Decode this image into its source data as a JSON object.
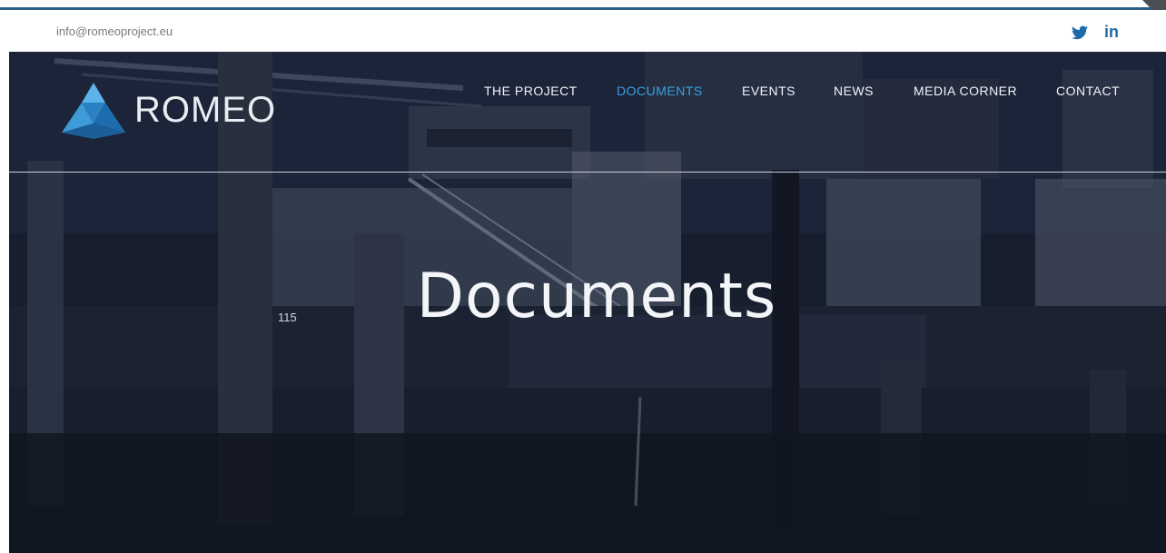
{
  "topbar": {
    "email": "info@romeoproject.eu",
    "social": [
      {
        "name": "twitter",
        "icon": "twitter-icon"
      },
      {
        "name": "linkedin",
        "label": "in",
        "icon": "linkedin-icon"
      }
    ]
  },
  "brand": {
    "name": "ROMEO",
    "logo_icon": "romeo-triangle-logo",
    "accent_color": "#3aa0e0"
  },
  "nav": {
    "items": [
      {
        "label": "THE PROJECT",
        "active": false
      },
      {
        "label": "DOCUMENTS",
        "active": true
      },
      {
        "label": "EVENTS",
        "active": false
      },
      {
        "label": "NEWS",
        "active": false
      },
      {
        "label": "MEDIA CORNER",
        "active": false
      },
      {
        "label": "CONTACT",
        "active": false
      }
    ]
  },
  "hero": {
    "title": "Documents",
    "image_label": "115"
  }
}
